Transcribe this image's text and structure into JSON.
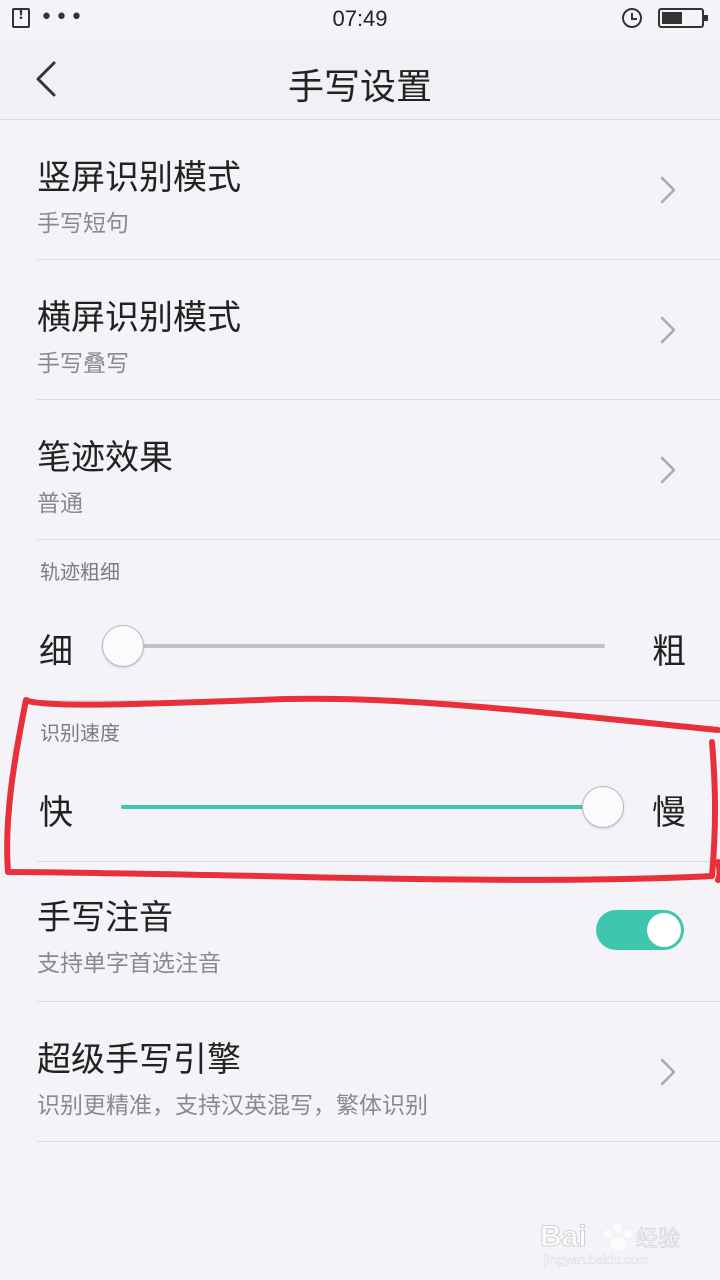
{
  "status_bar": {
    "time": "07:49",
    "dots": "•••"
  },
  "header": {
    "title": "手写设置"
  },
  "items": [
    {
      "title": "竖屏识别模式",
      "subtitle": "手写短句"
    },
    {
      "title": "横屏识别模式",
      "subtitle": "手写叠写"
    },
    {
      "title": "笔迹效果",
      "subtitle": "普通"
    }
  ],
  "stroke_width": {
    "label": "轨迹粗细",
    "min_label": "细",
    "max_label": "粗",
    "value_fraction": 0.0
  },
  "recognition_speed": {
    "label": "识别速度",
    "min_label": "快",
    "max_label": "慢",
    "value_fraction": 1.0
  },
  "phonetic": {
    "title": "手写注音",
    "subtitle": "支持单字首选注音",
    "enabled": true
  },
  "super_engine": {
    "title": "超级手写引擎",
    "subtitle": "识别更精准，支持汉英混写，繁体识别"
  },
  "colors": {
    "accent": "#3fc6ae",
    "annotation": "#e8303a",
    "background": "#f4f3f7"
  },
  "watermark": {
    "brand": "Bai du 经验",
    "url": "jingyan.baidu.com"
  }
}
